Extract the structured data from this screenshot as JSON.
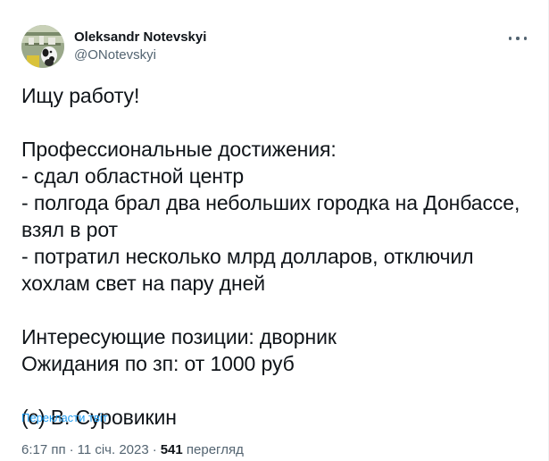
{
  "author": {
    "display_name": "Oleksandr Notevskyi",
    "handle": "@ONotevskyi",
    "avatar_icon": "avatar-dog-icon"
  },
  "tweet": {
    "lines": [
      "Ищу работу!",
      "",
      "Профессиональные достижения:",
      "- сдал областной центр",
      "- полгода брал два небольших городка на Донбассе,",
      "взял в рот",
      "- потратил несколько млрд долларов, отключил",
      "хохлам свет на пару дней",
      "",
      "Интересующие позиции: дворник",
      "Ожидания по зп: от 1000 руб",
      "",
      "(с) В. Суровикин"
    ],
    "translate_label": "Перекласти твіт"
  },
  "meta": {
    "time": "6:17 пп",
    "separator": "·",
    "date": "11 січ. 2023",
    "views_count": "541",
    "views_label": "перегляд"
  },
  "colors": {
    "text_primary": "#0f1419",
    "text_secondary": "#536471",
    "link": "#1d9bf0"
  }
}
